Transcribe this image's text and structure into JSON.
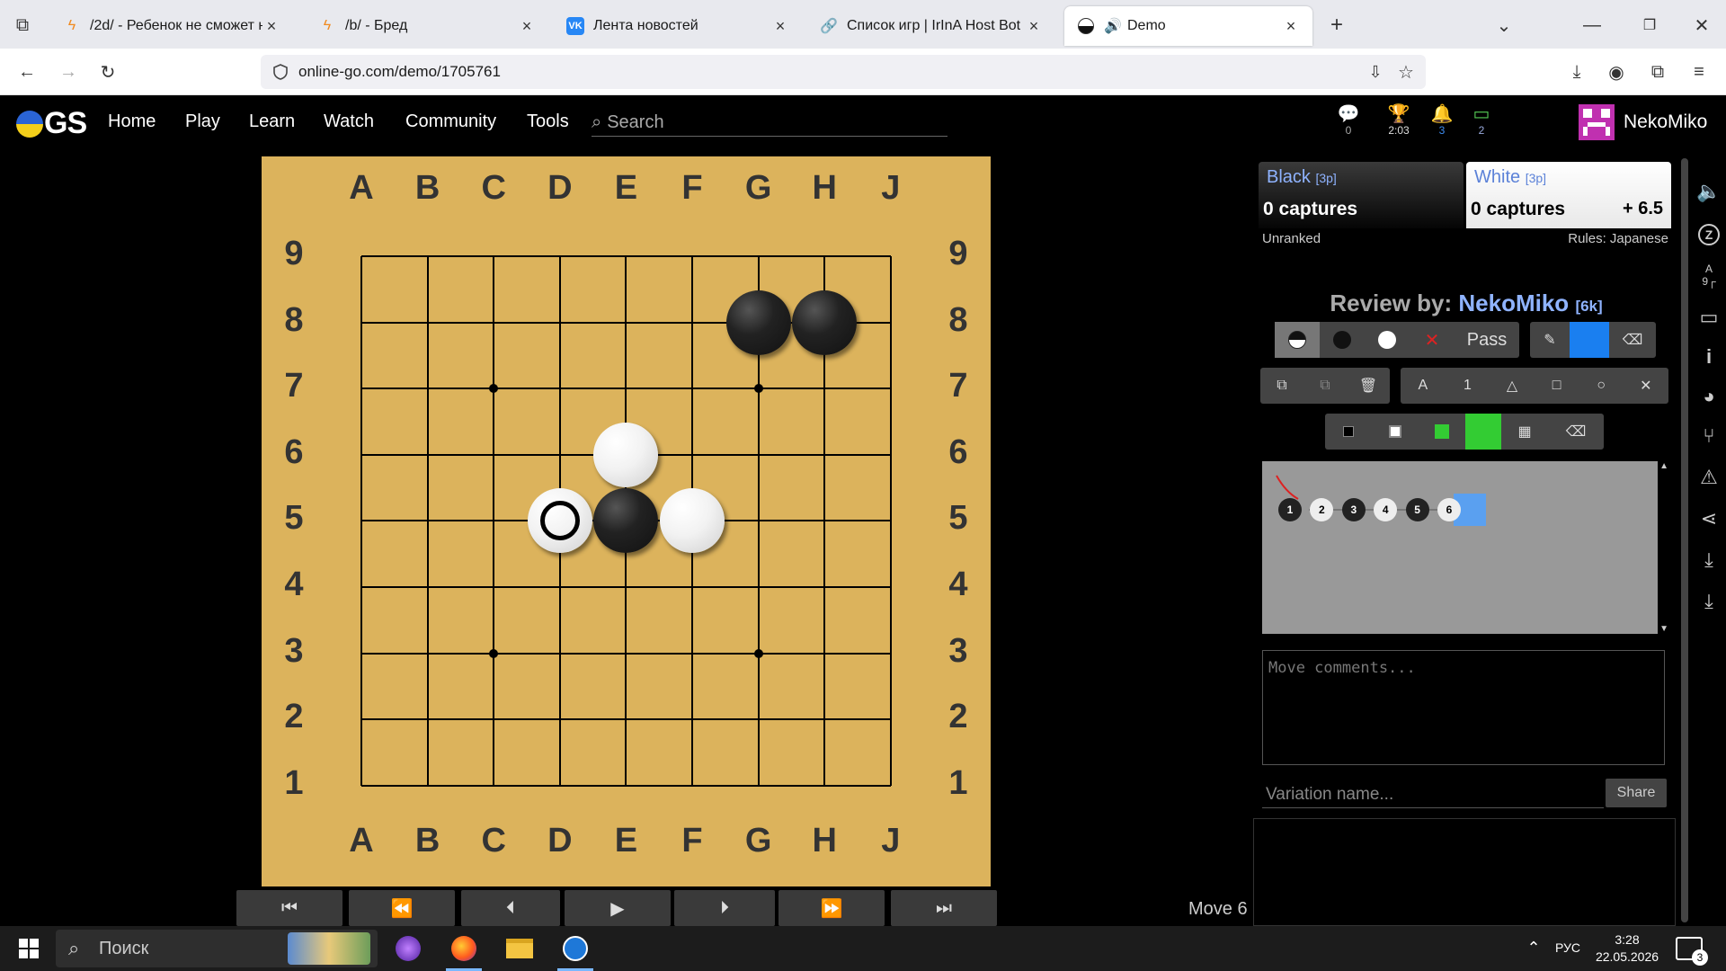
{
  "browser": {
    "tabs": [
      {
        "title": "/2d/ - Ребенок не сможет най",
        "icon": "bolt-icon"
      },
      {
        "title": "/b/ - Бред",
        "icon": "bolt-icon"
      },
      {
        "title": "Лента новостей",
        "icon": "vk-icon"
      },
      {
        "title": "Список игр | IrInA Host Bot",
        "icon": "link-icon"
      },
      {
        "title": "Demo",
        "icon": "ogs-icon"
      }
    ],
    "url": "online-go.com/demo/1705761"
  },
  "ogs_nav": {
    "logo": "GS",
    "links": [
      "Home",
      "Play",
      "Learn",
      "Watch",
      "Community",
      "Tools"
    ],
    "search_placeholder": "Search",
    "badges": {
      "chat": "0",
      "tournament": "2:03",
      "notifications": "3",
      "games": "2"
    },
    "username": "NekoMiko"
  },
  "board": {
    "columns": [
      "A",
      "B",
      "C",
      "D",
      "E",
      "F",
      "G",
      "H",
      "J"
    ],
    "rows": [
      "9",
      "8",
      "7",
      "6",
      "5",
      "4",
      "3",
      "2",
      "1"
    ],
    "stones": [
      {
        "color": "black",
        "point": "G8"
      },
      {
        "color": "black",
        "point": "H8"
      },
      {
        "color": "white",
        "point": "E6"
      },
      {
        "color": "white",
        "point": "D5",
        "last_move": true
      },
      {
        "color": "black",
        "point": "E5"
      },
      {
        "color": "white",
        "point": "F5"
      }
    ],
    "hoshi": [
      "C7",
      "G7",
      "C3",
      "G3"
    ]
  },
  "controls": {
    "buttons": [
      "⏮",
      "⏪",
      "⏴",
      "▶",
      "⏵",
      "⏩",
      "⏭"
    ],
    "move_label": "Move 6"
  },
  "players": {
    "black": {
      "name": "Black",
      "rank": "[3p]",
      "captures": "0 captures"
    },
    "white": {
      "name": "White",
      "rank": "[3p]",
      "captures": "0 captures",
      "komi": "+ 6.5"
    },
    "ranked": "Unranked",
    "rules": "Rules: Japanese"
  },
  "review": {
    "prefix": "Review by:",
    "reviewer": "NekoMiko",
    "rank": "[6k]",
    "pass_label": "Pass"
  },
  "marks_toolbar": [
    "A",
    "1",
    "△",
    "□",
    "○",
    "✕"
  ],
  "tree": {
    "nodes": [
      {
        "n": "1",
        "color": "black"
      },
      {
        "n": "2",
        "color": "white"
      },
      {
        "n": "3",
        "color": "black"
      },
      {
        "n": "4",
        "color": "white"
      },
      {
        "n": "5",
        "color": "black"
      },
      {
        "n": "6",
        "color": "white"
      }
    ]
  },
  "comments_placeholder": "Move comments...",
  "variation_placeholder": "Variation name...",
  "share_label": "Share",
  "colors": {
    "accent": "#8fb3ff",
    "board": "#dcb35c",
    "pen_blue": "#1a7ff0",
    "green": "#33cc33"
  },
  "taskbar": {
    "search_label": "Поиск",
    "lang": "РУС",
    "time": "3:28",
    "date": "22.05.2026",
    "notif_count": "3"
  }
}
